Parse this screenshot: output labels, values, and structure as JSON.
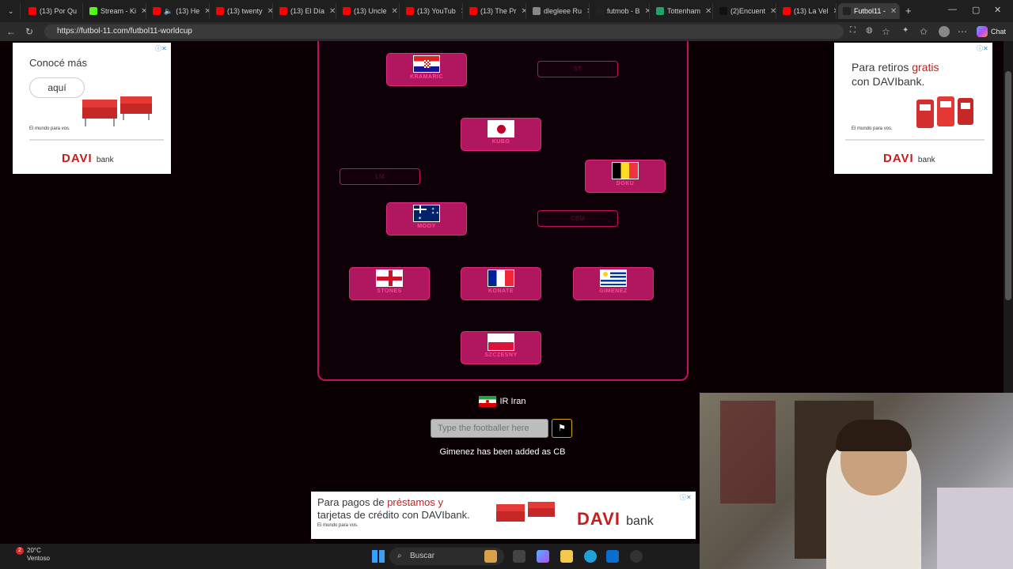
{
  "browser": {
    "tabs": [
      {
        "label": "(13) Por Qu",
        "color": "#ff0000"
      },
      {
        "label": "Stream - Ki",
        "color": "#53fc18"
      },
      {
        "label": "(13) He",
        "color": "#ff0000"
      },
      {
        "label": "(13) twenty",
        "color": "#ff0000"
      },
      {
        "label": "(13) El Día",
        "color": "#ff0000"
      },
      {
        "label": "(13) Uncle",
        "color": "#ff0000"
      },
      {
        "label": "(13) YouTub",
        "color": "#ff0000"
      },
      {
        "label": "(13) The Pr",
        "color": "#ff0000"
      },
      {
        "label": "dlegleee Ru",
        "color": "#888888"
      },
      {
        "label": "futmob - B",
        "color": "#222222"
      },
      {
        "label": "Tottenham",
        "color": "#1fa463"
      },
      {
        "label": "(2)Encuent",
        "color": "#111111"
      },
      {
        "label": "(13) La Vel",
        "color": "#ff0000"
      },
      {
        "label": "Futbol11 -",
        "color": "#222222"
      }
    ],
    "url": "https://futbol-11.com/futbol11-worldcup",
    "chat_label": "Chat"
  },
  "ads": {
    "left": {
      "headline": "Conocé más",
      "cta": "aquí",
      "brand": "DAVI",
      "brand_sub": "bank",
      "tagline": "El mundo para vos."
    },
    "right": {
      "headline_1": "Para retiros",
      "headline_accent": "gratis",
      "headline_2": "con DAVIbank.",
      "brand": "DAVI",
      "brand_sub": "bank",
      "tagline": "El mundo para vos."
    },
    "bottom": {
      "line1": "Para pagos de",
      "line1_accent": "préstamos y",
      "line2": "tarjetas de crédito con DAVIbank.",
      "brand": "DAVI",
      "brand_sub": "bank",
      "tagline": "El mundo para vos."
    }
  },
  "formation": {
    "players": [
      {
        "name": "KRAMARIC",
        "flag": "croatia"
      },
      {
        "name": "KUBO",
        "flag": "japan"
      },
      {
        "name": "DOKU",
        "flag": "belgium"
      },
      {
        "name": "MOOY",
        "flag": "australia"
      },
      {
        "name": "STONES",
        "flag": "england"
      },
      {
        "name": "KONATE",
        "flag": "france"
      },
      {
        "name": "GIMENEZ",
        "flag": "uruguay"
      },
      {
        "name": "SZCZESNY",
        "flag": "poland"
      }
    ],
    "empty_slots": [
      "ST",
      "LM",
      "CBM"
    ]
  },
  "game": {
    "team_name": "IR Iran",
    "input_placeholder": "Type the footballer here",
    "submit_icon": "flag-icon",
    "status_message": "Gimenez has been added as CB"
  },
  "taskbar": {
    "temperature": "20°C",
    "weather": "Ventoso",
    "notification_count": "2",
    "search_label": "Buscar"
  }
}
